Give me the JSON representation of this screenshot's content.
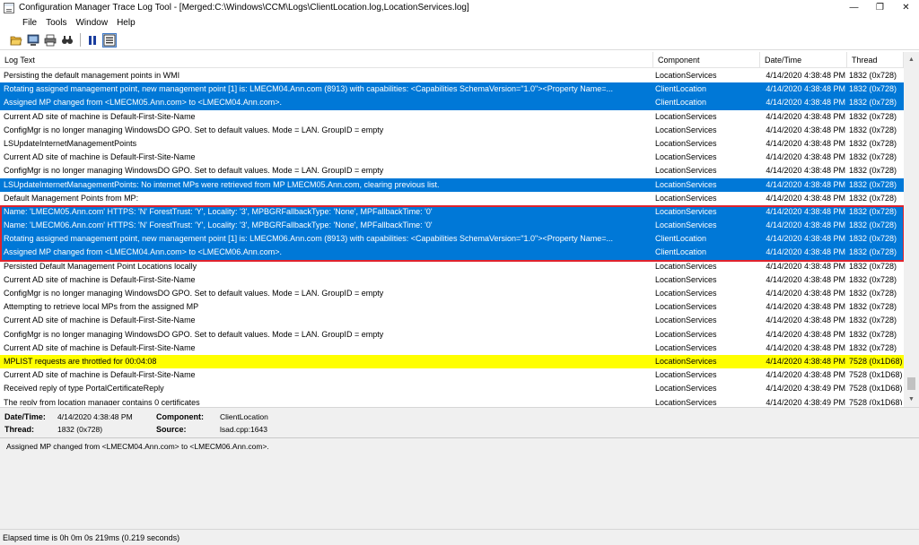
{
  "window": {
    "title": "Configuration Manager Trace Log Tool - [Merged:C:\\Windows\\CCM\\Logs\\ClientLocation.log,LocationServices.log]",
    "minimize_glyph": "—",
    "maximize_glyph": "❐",
    "close_glyph": "✕"
  },
  "menu": [
    "File",
    "Tools",
    "Window",
    "Help"
  ],
  "toolbar": {
    "icons": [
      "open-folder-icon",
      "open-remote-icon",
      "print-icon",
      "find-icon",
      "pause-icon",
      "highlight-icon"
    ]
  },
  "columns": [
    "Log Text",
    "Component",
    "Date/Time",
    "Thread"
  ],
  "colors": {
    "selection": "#0078d7",
    "highlight": "#ffff00",
    "annotation": "#e0232d"
  },
  "rows": [
    {
      "text": "Persisting the default management points in WMI",
      "component": "LocationServices",
      "datetime": "4/14/2020 4:38:48 PM",
      "thread": "1832 (0x728)",
      "state": ""
    },
    {
      "text": "Rotating assigned management point, new management point [1] is: LMECM04.Ann.com (8913) with capabilities: <Capabilities SchemaVersion=\"1.0\"><Property Name=...",
      "component": "ClientLocation",
      "datetime": "4/14/2020 4:38:48 PM",
      "thread": "1832 (0x728)",
      "state": "sel"
    },
    {
      "text": "Assigned MP changed from <LMECM05.Ann.com> to <LMECM04.Ann.com>.",
      "component": "ClientLocation",
      "datetime": "4/14/2020 4:38:48 PM",
      "thread": "1832 (0x728)",
      "state": "sel"
    },
    {
      "text": "Current AD site of machine is Default-First-Site-Name",
      "component": "LocationServices",
      "datetime": "4/14/2020 4:38:48 PM",
      "thread": "1832 (0x728)",
      "state": ""
    },
    {
      "text": "ConfigMgr is no longer managing WindowsDO GPO.  Set to default values. Mode = LAN. GroupID = empty",
      "component": "LocationServices",
      "datetime": "4/14/2020 4:38:48 PM",
      "thread": "1832 (0x728)",
      "state": ""
    },
    {
      "text": "LSUpdateInternetManagementPoints",
      "component": "LocationServices",
      "datetime": "4/14/2020 4:38:48 PM",
      "thread": "1832 (0x728)",
      "state": ""
    },
    {
      "text": "Current AD site of machine is Default-First-Site-Name",
      "component": "LocationServices",
      "datetime": "4/14/2020 4:38:48 PM",
      "thread": "1832 (0x728)",
      "state": ""
    },
    {
      "text": "ConfigMgr is no longer managing WindowsDO GPO.  Set to default values. Mode = LAN. GroupID = empty",
      "component": "LocationServices",
      "datetime": "4/14/2020 4:38:48 PM",
      "thread": "1832 (0x728)",
      "state": ""
    },
    {
      "text": "LSUpdateInternetManagementPoints: No internet MPs were retrieved from MP LMECM05.Ann.com, clearing previous list.",
      "component": "LocationServices",
      "datetime": "4/14/2020 4:38:48 PM",
      "thread": "1832 (0x728)",
      "state": "sel"
    },
    {
      "text": "Default Management Points from MP:",
      "component": "LocationServices",
      "datetime": "4/14/2020 4:38:48 PM",
      "thread": "1832 (0x728)",
      "state": ""
    },
    {
      "text": "Name: 'LMECM05.Ann.com' HTTPS: 'N' ForestTrust: 'Y', Locality: '3', MPBGRFallbackType: 'None', MPFallbackTime: '0'",
      "component": "LocationServices",
      "datetime": "4/14/2020 4:38:48 PM",
      "thread": "1832 (0x728)",
      "state": "sel"
    },
    {
      "text": "Name: 'LMECM06.Ann.com' HTTPS: 'N' ForestTrust: 'Y', Locality: '3', MPBGRFallbackType: 'None', MPFallbackTime: '0'",
      "component": "LocationServices",
      "datetime": "4/14/2020 4:38:48 PM",
      "thread": "1832 (0x728)",
      "state": "sel"
    },
    {
      "text": "Rotating assigned management point, new management point [1] is: LMECM06.Ann.com (8913) with capabilities: <Capabilities SchemaVersion=\"1.0\"><Property Name=...",
      "component": "ClientLocation",
      "datetime": "4/14/2020 4:38:48 PM",
      "thread": "1832 (0x728)",
      "state": "sel"
    },
    {
      "text": "Assigned MP changed from <LMECM04.Ann.com> to <LMECM06.Ann.com>.",
      "component": "ClientLocation",
      "datetime": "4/14/2020 4:38:48 PM",
      "thread": "1832 (0x728)",
      "state": "sel"
    },
    {
      "text": "Persisted Default Management Point Locations locally",
      "component": "LocationServices",
      "datetime": "4/14/2020 4:38:48 PM",
      "thread": "1832 (0x728)",
      "state": ""
    },
    {
      "text": "Current AD site of machine is Default-First-Site-Name",
      "component": "LocationServices",
      "datetime": "4/14/2020 4:38:48 PM",
      "thread": "1832 (0x728)",
      "state": ""
    },
    {
      "text": "ConfigMgr is no longer managing WindowsDO GPO.  Set to default values. Mode = LAN. GroupID = empty",
      "component": "LocationServices",
      "datetime": "4/14/2020 4:38:48 PM",
      "thread": "1832 (0x728)",
      "state": ""
    },
    {
      "text": "Attempting to retrieve local MPs from the assigned MP",
      "component": "LocationServices",
      "datetime": "4/14/2020 4:38:48 PM",
      "thread": "1832 (0x728)",
      "state": ""
    },
    {
      "text": "Current AD site of machine is Default-First-Site-Name",
      "component": "LocationServices",
      "datetime": "4/14/2020 4:38:48 PM",
      "thread": "1832 (0x728)",
      "state": ""
    },
    {
      "text": "ConfigMgr is no longer managing WindowsDO GPO.  Set to default values. Mode = LAN. GroupID = empty",
      "component": "LocationServices",
      "datetime": "4/14/2020 4:38:48 PM",
      "thread": "1832 (0x728)",
      "state": ""
    },
    {
      "text": "Current AD site of machine is Default-First-Site-Name",
      "component": "LocationServices",
      "datetime": "4/14/2020 4:38:48 PM",
      "thread": "1832 (0x728)",
      "state": ""
    },
    {
      "text": "MPLIST requests are throttled for 00:04:08",
      "component": "LocationServices",
      "datetime": "4/14/2020 4:38:48 PM",
      "thread": "7528 (0x1D68)",
      "state": "warn"
    },
    {
      "text": "Current AD site of machine is Default-First-Site-Name",
      "component": "LocationServices",
      "datetime": "4/14/2020 4:38:48 PM",
      "thread": "7528 (0x1D68)",
      "state": ""
    },
    {
      "text": "Received reply of type PortalCertificateReply",
      "component": "LocationServices",
      "datetime": "4/14/2020 4:38:49 PM",
      "thread": "7528 (0x1D68)",
      "state": ""
    },
    {
      "text": "The reply from location manager contains 0 certificates",
      "component": "LocationServices",
      "datetime": "4/14/2020 4:38:49 PM",
      "thread": "7528 (0x1D68)",
      "state": ""
    }
  ],
  "details": {
    "datetime_label": "Date/Time:",
    "datetime_value": "4/14/2020 4:38:48 PM",
    "component_label": "Component:",
    "component_value": "ClientLocation",
    "thread_label": "Thread:",
    "thread_value": "1832 (0x728)",
    "source_label": "Source:",
    "source_value": "lsad.cpp:1643"
  },
  "message": "Assigned MP changed from <LMECM04.Ann.com> to <LMECM06.Ann.com>.",
  "status": "Elapsed time is 0h 0m 0s 219ms (0.219 seconds)"
}
